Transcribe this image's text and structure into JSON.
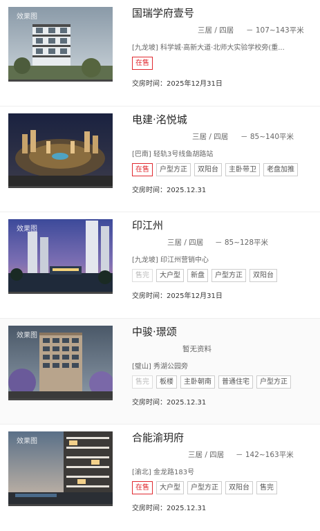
{
  "watermark": "效果图",
  "delivery_label": "交房时间：",
  "listings": [
    {
      "name": "国瑞学府壹号",
      "layout": "三居 / 四居",
      "area": "－ 107~143平米",
      "address": "[九龙坡] 科学城·高新大道·北师大实验学校旁(重...",
      "tags": [
        {
          "label": "在售",
          "style": "red"
        }
      ],
      "delivery": "2025年12月31日"
    },
    {
      "name": "电建·洺悦城",
      "layout": "三居 / 四居",
      "area": "－ 85~140平米",
      "address": "[巴南] 轻轨3号线鱼胡路站",
      "tags": [
        {
          "label": "在售",
          "style": "red"
        },
        {
          "label": "户型方正",
          "style": "normal"
        },
        {
          "label": "双阳台",
          "style": "normal"
        },
        {
          "label": "主卧带卫",
          "style": "normal"
        },
        {
          "label": "老盘加推",
          "style": "normal"
        }
      ],
      "delivery": "2025.12.31"
    },
    {
      "name": "印江州",
      "layout": "三居 / 四居",
      "area": "－ 85~128平米",
      "address": "[九龙坡] 印江州营销中心",
      "tags": [
        {
          "label": "售完",
          "style": "grey"
        },
        {
          "label": "大户型",
          "style": "normal"
        },
        {
          "label": "新盘",
          "style": "normal"
        },
        {
          "label": "户型方正",
          "style": "normal"
        },
        {
          "label": "双阳台",
          "style": "normal"
        }
      ],
      "delivery": "2025年12月31日"
    },
    {
      "name": "中骏·璟颂",
      "layout": "",
      "area": "暂无资料",
      "address": "[璧山] 秀湖公园旁",
      "tags": [
        {
          "label": "售完",
          "style": "grey"
        },
        {
          "label": "板楼",
          "style": "normal"
        },
        {
          "label": "主卧朝南",
          "style": "normal"
        },
        {
          "label": "普通住宅",
          "style": "normal"
        },
        {
          "label": "户型方正",
          "style": "normal"
        }
      ],
      "delivery": "2025.12.31"
    },
    {
      "name": "合能渝玥府",
      "layout": "三居 / 四居",
      "area": "－ 142~163平米",
      "address": "[渝北] 金龙路183号",
      "tags": [
        {
          "label": "在售",
          "style": "red"
        },
        {
          "label": "大户型",
          "style": "normal"
        },
        {
          "label": "户型方正",
          "style": "normal"
        },
        {
          "label": "双阳台",
          "style": "normal"
        },
        {
          "label": "售完",
          "style": "normal"
        }
      ],
      "delivery": "2025.12.31"
    }
  ]
}
